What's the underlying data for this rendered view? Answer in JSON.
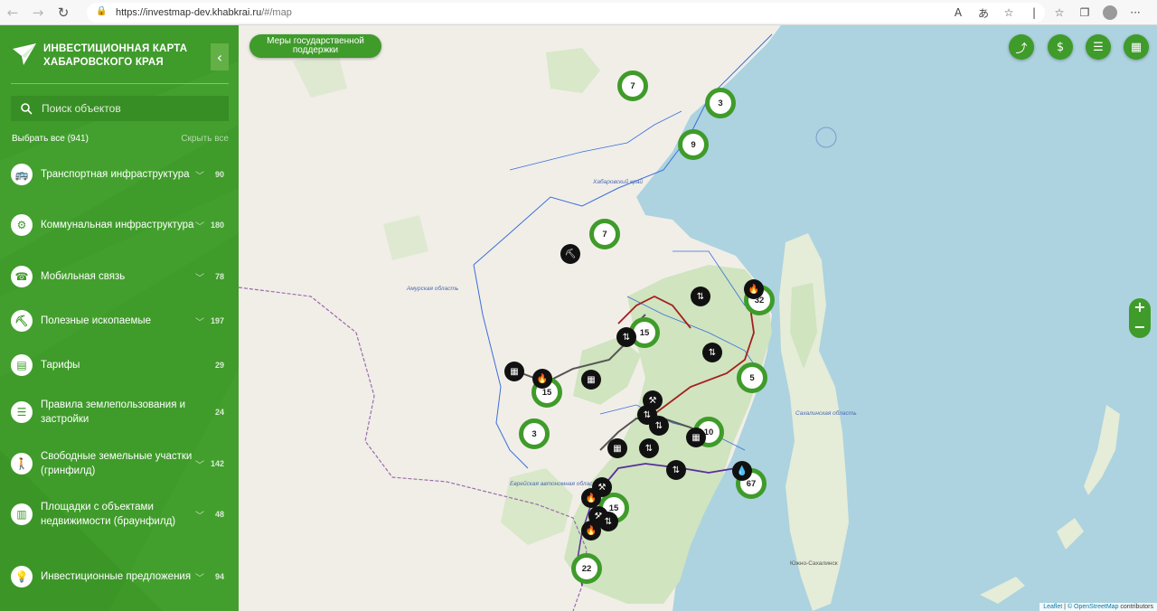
{
  "browser": {
    "url_host": "https://investmap-dev.khabkrai.ru",
    "url_path": "/#/map",
    "back_icon": "arrow-left-icon",
    "forward_icon": "arrow-right-icon",
    "reload_icon": "reload-icon"
  },
  "sidebar": {
    "title": "Инвестиционная карта Хабаровского края",
    "search_placeholder": "Поиск объектов",
    "select_all": "Выбрать все (941)",
    "hide_all": "Скрыть все",
    "items": [
      {
        "label": "Транспортная инфраструктура",
        "count": "90",
        "icon": "bus-icon"
      },
      {
        "label": "Коммунальная инфраструктура",
        "count": "180",
        "icon": "utility-icon"
      },
      {
        "label": "Мобильная связь",
        "count": "78",
        "icon": "phone-icon"
      },
      {
        "label": "Полезные ископаемые",
        "count": "197",
        "icon": "pickaxe-icon"
      },
      {
        "label": "Тарифы",
        "count": "29",
        "icon": "tariff-icon"
      },
      {
        "label": "Правила землепользования и застройки",
        "count": "24",
        "icon": "rules-icon"
      },
      {
        "label": "Свободные земельные участки (гринфилд)",
        "count": "142",
        "icon": "hiker-icon"
      },
      {
        "label": "Площадки с объектами недвижимости (браунфилд)",
        "count": "48",
        "icon": "factory-icon"
      },
      {
        "label": "Инвестиционные предложения",
        "count": "94",
        "icon": "lightbulb-icon"
      }
    ]
  },
  "map": {
    "measures_button": "Меры государственной поддержки",
    "clusters": [
      "7",
      "3",
      "9",
      "7",
      "15",
      "32",
      "5",
      "15",
      "3",
      "10",
      "67",
      "15",
      "22"
    ],
    "labels": {
      "khab": "Хабаровский край",
      "amur": "Амурская область",
      "eao": "Еврейская автономная область",
      "sakh": "Сахалинская область",
      "yuzhno": "Южно-Сахалинск"
    },
    "attribution": {
      "leaflet": "Leaflet",
      "osm": "© OpenStreetMap",
      "rest": " contributors"
    },
    "accent": "#3f9b2a"
  }
}
